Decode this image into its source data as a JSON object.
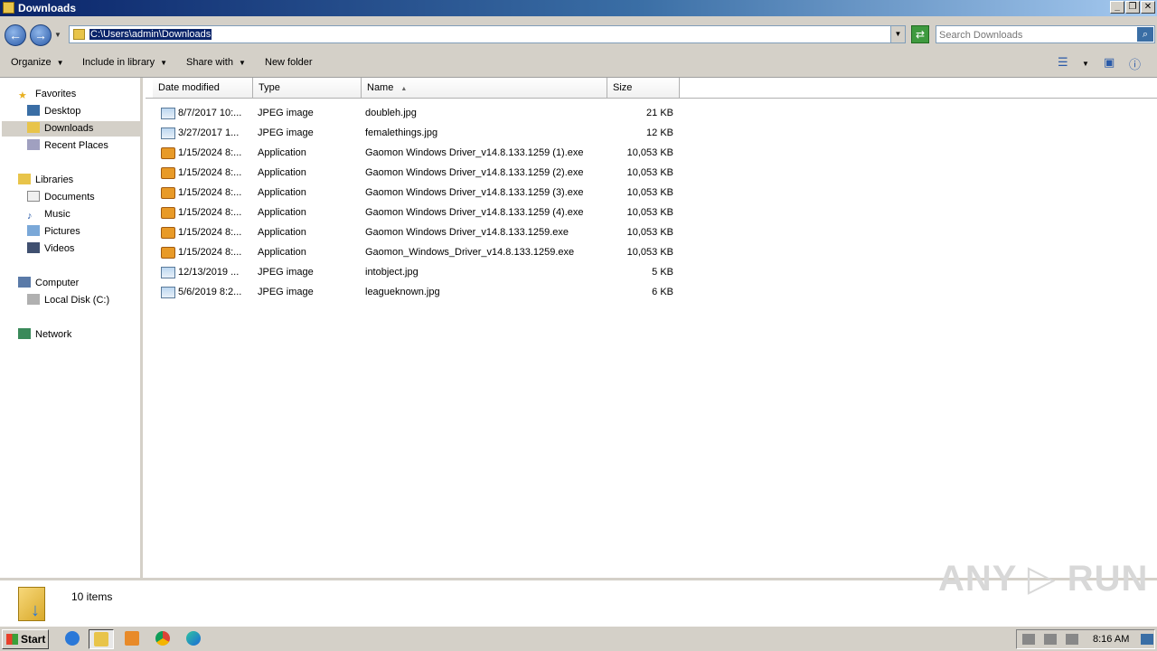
{
  "window": {
    "title": "Downloads"
  },
  "titlebar_buttons": {
    "minimize": "_",
    "restore": "❐",
    "close": "✕"
  },
  "address": {
    "path": "C:\\Users\\admin\\Downloads"
  },
  "search": {
    "placeholder": "Search Downloads"
  },
  "toolbar": {
    "organize": "Organize",
    "include_in_library": "Include in library",
    "share_with": "Share with",
    "new_folder": "New folder"
  },
  "nav": {
    "favorites": "Favorites",
    "desktop": "Desktop",
    "downloads": "Downloads",
    "recent_places": "Recent Places",
    "libraries": "Libraries",
    "documents": "Documents",
    "music": "Music",
    "pictures": "Pictures",
    "videos": "Videos",
    "computer": "Computer",
    "local_disk": "Local Disk (C:)",
    "network": "Network"
  },
  "columns": {
    "date": "Date modified",
    "type": "Type",
    "name": "Name",
    "size": "Size"
  },
  "files": [
    {
      "date": "8/7/2017 10:...",
      "type": "JPEG image",
      "name": "doubleh.jpg",
      "size": "21 KB",
      "icon": "image"
    },
    {
      "date": "3/27/2017 1...",
      "type": "JPEG image",
      "name": "femalethings.jpg",
      "size": "12 KB",
      "icon": "image"
    },
    {
      "date": "1/15/2024 8:...",
      "type": "Application",
      "name": "Gaomon Windows Driver_v14.8.133.1259 (1).exe",
      "size": "10,053 KB",
      "icon": "exe"
    },
    {
      "date": "1/15/2024 8:...",
      "type": "Application",
      "name": "Gaomon Windows Driver_v14.8.133.1259 (2).exe",
      "size": "10,053 KB",
      "icon": "exe"
    },
    {
      "date": "1/15/2024 8:...",
      "type": "Application",
      "name": "Gaomon Windows Driver_v14.8.133.1259 (3).exe",
      "size": "10,053 KB",
      "icon": "exe"
    },
    {
      "date": "1/15/2024 8:...",
      "type": "Application",
      "name": "Gaomon Windows Driver_v14.8.133.1259 (4).exe",
      "size": "10,053 KB",
      "icon": "exe"
    },
    {
      "date": "1/15/2024 8:...",
      "type": "Application",
      "name": "Gaomon Windows Driver_v14.8.133.1259.exe",
      "size": "10,053 KB",
      "icon": "exe"
    },
    {
      "date": "1/15/2024 8:...",
      "type": "Application",
      "name": "Gaomon_Windows_Driver_v14.8.133.1259.exe",
      "size": "10,053 KB",
      "icon": "exe"
    },
    {
      "date": "12/13/2019 ...",
      "type": "JPEG image",
      "name": "intobject.jpg",
      "size": "5 KB",
      "icon": "image"
    },
    {
      "date": "5/6/2019 8:2...",
      "type": "JPEG image",
      "name": "leagueknown.jpg",
      "size": "6 KB",
      "icon": "image"
    }
  ],
  "details": {
    "item_count": "10 items"
  },
  "watermark": "ANY ▷ RUN",
  "taskbar": {
    "start": "Start",
    "clock": "8:16 AM"
  }
}
